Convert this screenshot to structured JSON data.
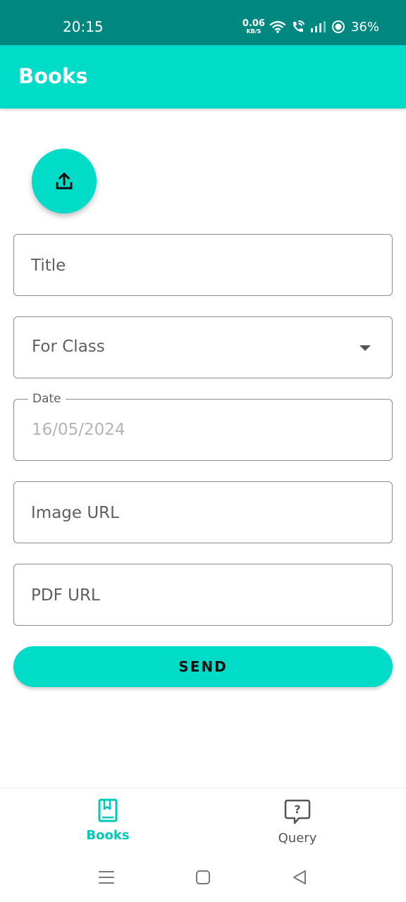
{
  "status_bar": {
    "time": "20:15",
    "net_speed_value": "0.06",
    "net_speed_unit": "KB/S",
    "battery": "36%",
    "icons": [
      "wifi-icon",
      "wifi-calling-icon",
      "signal-icon",
      "battery-saver-icon"
    ]
  },
  "app_bar": {
    "title": "Books"
  },
  "upload_button": {
    "icon": "upload-icon"
  },
  "form": {
    "title_placeholder": "Title",
    "class_placeholder": "For Class",
    "date_label": "Date",
    "date_value": "16/05/2024",
    "image_url_placeholder": "Image URL",
    "pdf_url_placeholder": "PDF URL",
    "send_label": "SEND"
  },
  "bottom_nav": {
    "items": [
      {
        "label": "Books",
        "icon": "book-icon",
        "active": true
      },
      {
        "label": "Query",
        "icon": "question-bubble-icon",
        "active": false
      }
    ]
  },
  "system_nav": [
    "menu-icon",
    "home-icon",
    "back-icon"
  ],
  "colors": {
    "status_bar": "#00877f",
    "accent": "#00dcc7",
    "active_nav": "#00c9b6"
  }
}
